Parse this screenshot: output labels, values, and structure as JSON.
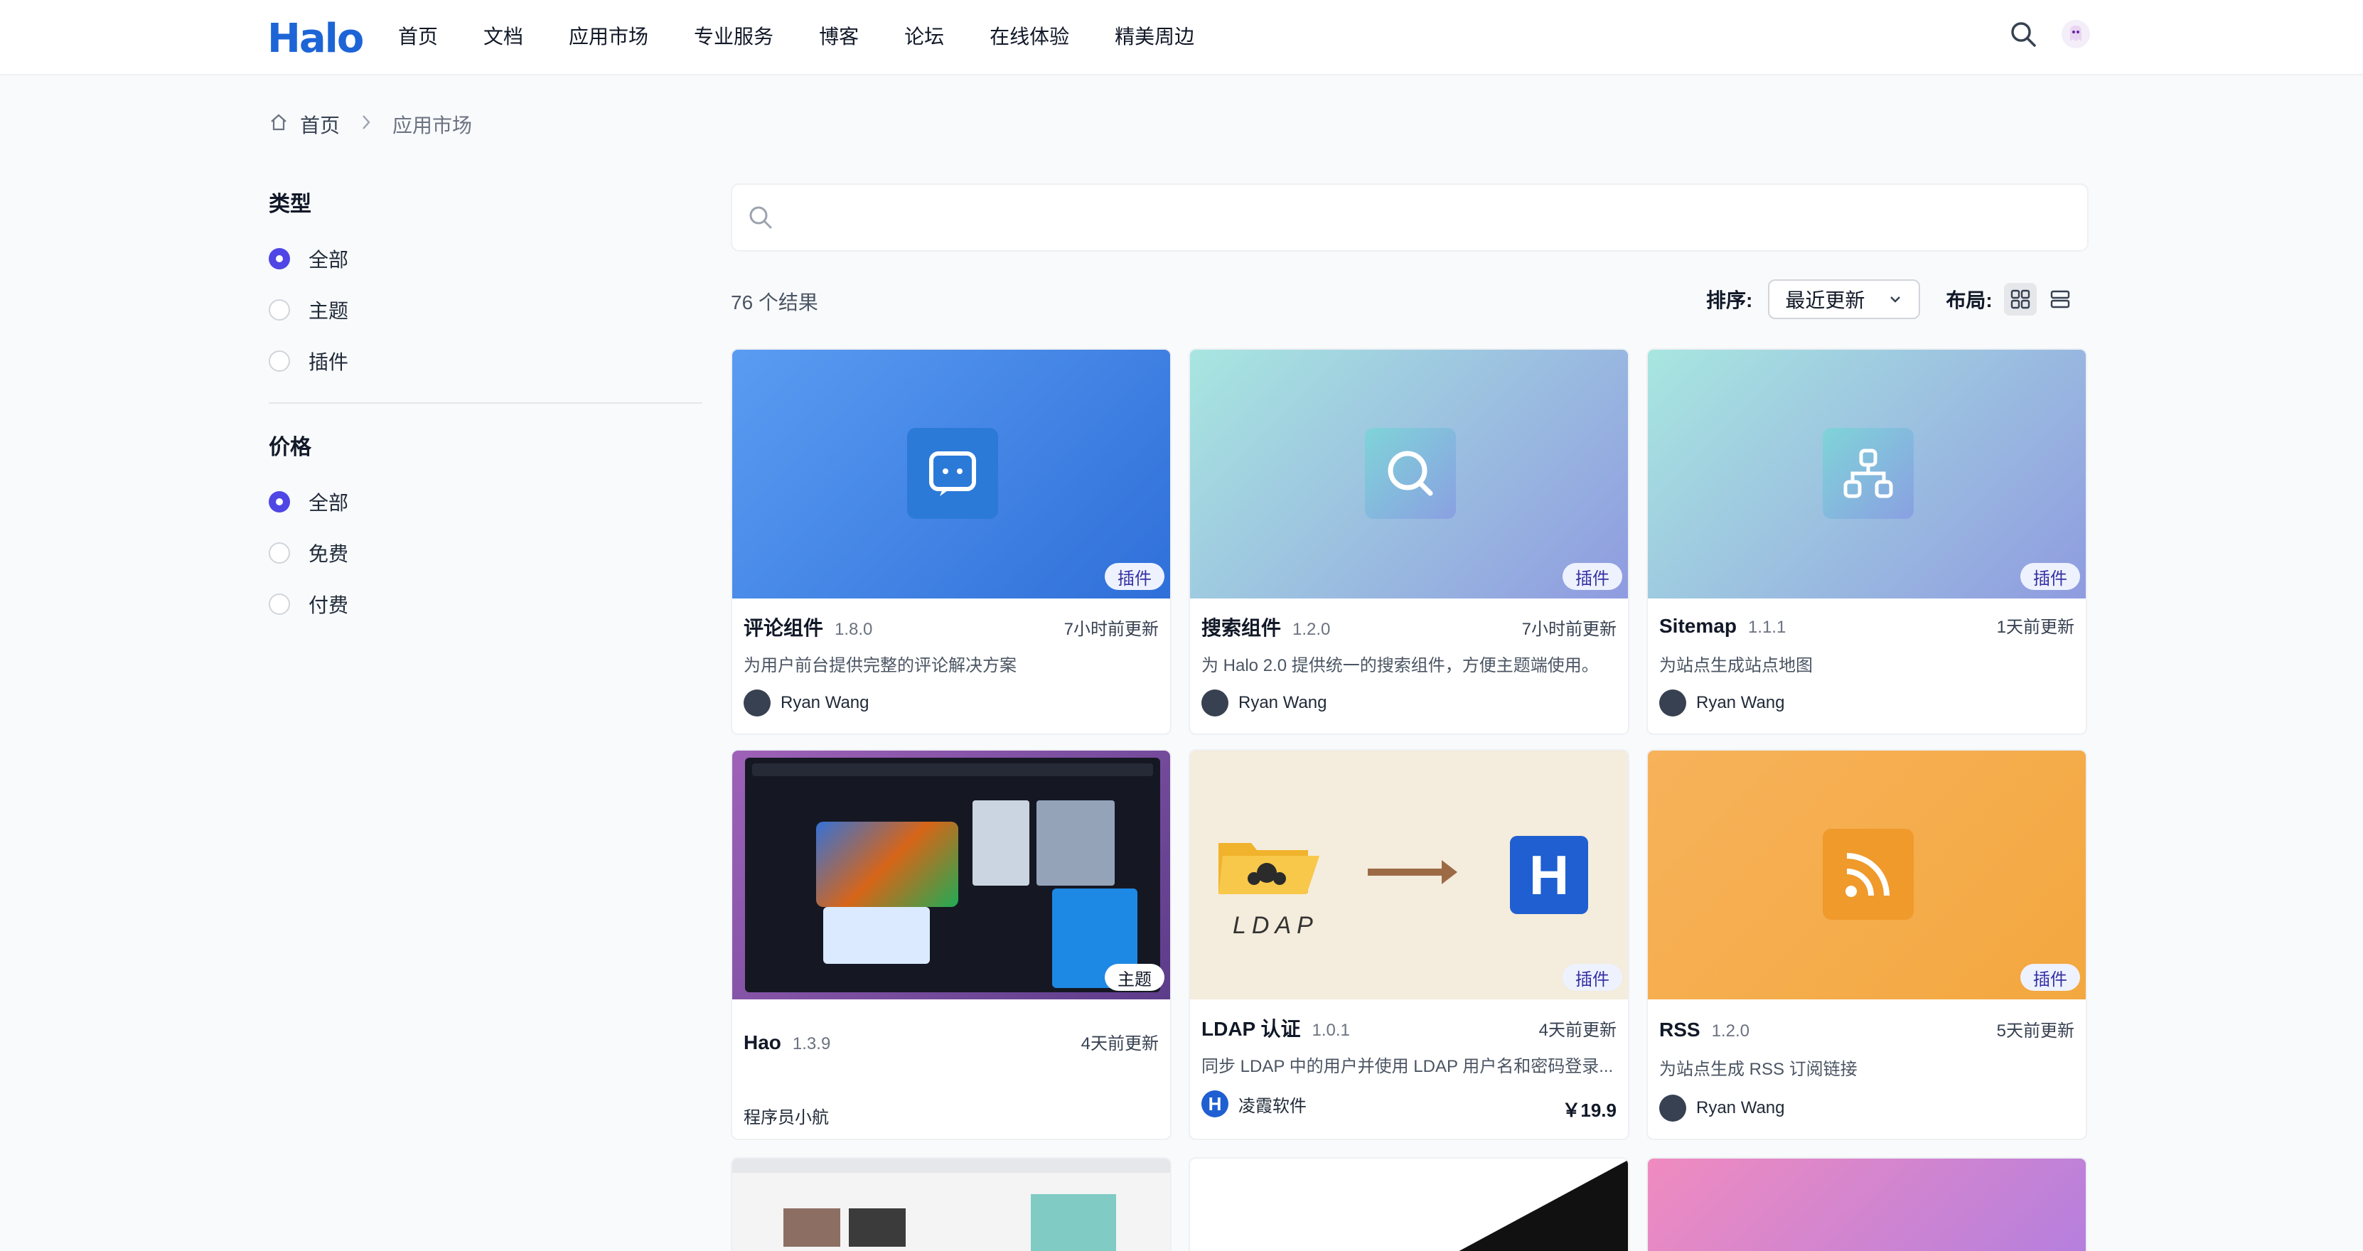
{
  "header": {
    "logo": "Halo",
    "nav": [
      "首页",
      "文档",
      "应用市场",
      "专业服务",
      "博客",
      "论坛",
      "在线体验",
      "精美周边"
    ]
  },
  "breadcrumb": {
    "home": "首页",
    "current": "应用市场"
  },
  "filters": {
    "type_title": "类型",
    "type_options": [
      "全部",
      "主题",
      "插件"
    ],
    "type_selected": "全部",
    "price_title": "价格",
    "price_options": [
      "全部",
      "免费",
      "付费"
    ],
    "price_selected": "全部"
  },
  "search": {
    "placeholder": ""
  },
  "results": {
    "count_text": "76 个结果"
  },
  "sort": {
    "label": "排序:",
    "value": "最近更新",
    "layout_label": "布局:"
  },
  "cards": [
    {
      "name": "评论组件",
      "version": "1.8.0",
      "updated": "7小时前更新",
      "desc": "为用户前台提供完整的评论解决方案",
      "author": "Ryan Wang",
      "tag": "插件",
      "price": "",
      "icon": "comment-icon"
    },
    {
      "name": "搜索组件",
      "version": "1.2.0",
      "updated": "7小时前更新",
      "desc": "为 Halo 2.0 提供统一的搜索组件，方便主题端使用。",
      "author": "Ryan Wang",
      "tag": "插件",
      "price": "",
      "icon": "search-icon"
    },
    {
      "name": "Sitemap",
      "version": "1.1.1",
      "updated": "1天前更新",
      "desc": "为站点生成站点地图",
      "author": "Ryan Wang",
      "tag": "插件",
      "price": "",
      "icon": "sitemap-icon"
    },
    {
      "name": "Hao",
      "version": "1.3.9",
      "updated": "4天前更新",
      "desc": "",
      "author": "程序员小航",
      "tag": "主题",
      "price": "",
      "icon": "theme-preview"
    },
    {
      "name": "LDAP 认证",
      "version": "1.0.1",
      "updated": "4天前更新",
      "desc": "同步 LDAP 中的用户并使用 LDAP 用户名和密码登录...",
      "author": "凌霞软件",
      "tag": "插件",
      "price": "￥19.9",
      "icon": "ldap-icon",
      "cover_text": "LDAP"
    },
    {
      "name": "RSS",
      "version": "1.2.0",
      "updated": "5天前更新",
      "desc": "为站点生成 RSS 订阅链接",
      "author": "Ryan Wang",
      "tag": "插件",
      "price": "",
      "icon": "rss-icon"
    }
  ]
}
